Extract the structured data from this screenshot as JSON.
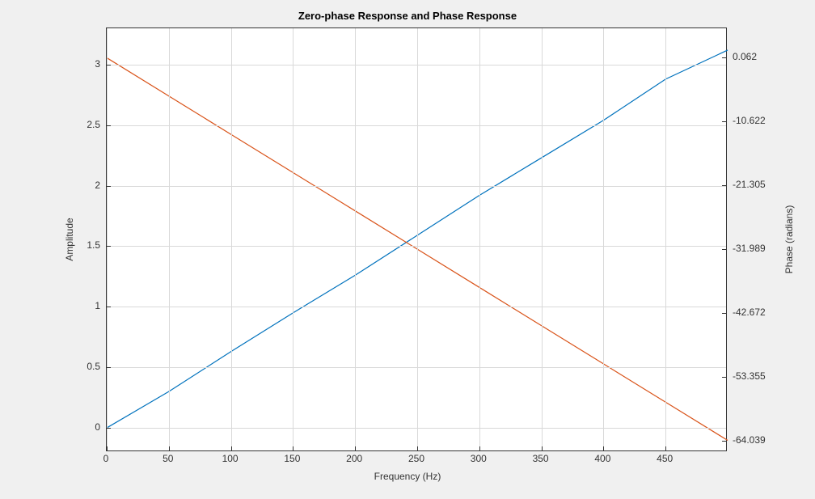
{
  "chart_data": {
    "type": "line",
    "title": "Zero-phase Response and Phase Response",
    "xlabel": "Frequency (Hz)",
    "ylabel_left": "Amplitude",
    "ylabel_right": "Phase (radians)",
    "xlim": [
      0,
      500
    ],
    "ylim_left": [
      -0.2,
      3.3
    ],
    "ylim_right": [
      -66,
      5
    ],
    "x": [
      0,
      50,
      100,
      150,
      200,
      250,
      300,
      350,
      400,
      450,
      500
    ],
    "xticks": [
      0,
      50,
      100,
      150,
      200,
      250,
      300,
      350,
      400,
      450
    ],
    "yticks_left": [
      0,
      0.5,
      1,
      1.5,
      2,
      2.5,
      3
    ],
    "yticks_right": [
      -64.039,
      -53.355,
      -42.672,
      -31.989,
      -21.305,
      -10.622,
      0.062
    ],
    "series": [
      {
        "name": "Amplitude",
        "axis": "left",
        "color": "#0072BD",
        "values": [
          0.0,
          0.3,
          0.63,
          0.95,
          1.26,
          1.59,
          1.92,
          2.23,
          2.54,
          2.88,
          3.12
        ]
      },
      {
        "name": "Phase",
        "axis": "right",
        "color": "#D95319",
        "values": [
          0.062,
          -6.35,
          -12.76,
          -19.17,
          -25.58,
          -31.99,
          -38.4,
          -44.81,
          -51.22,
          -57.63,
          -64.039
        ]
      }
    ]
  }
}
